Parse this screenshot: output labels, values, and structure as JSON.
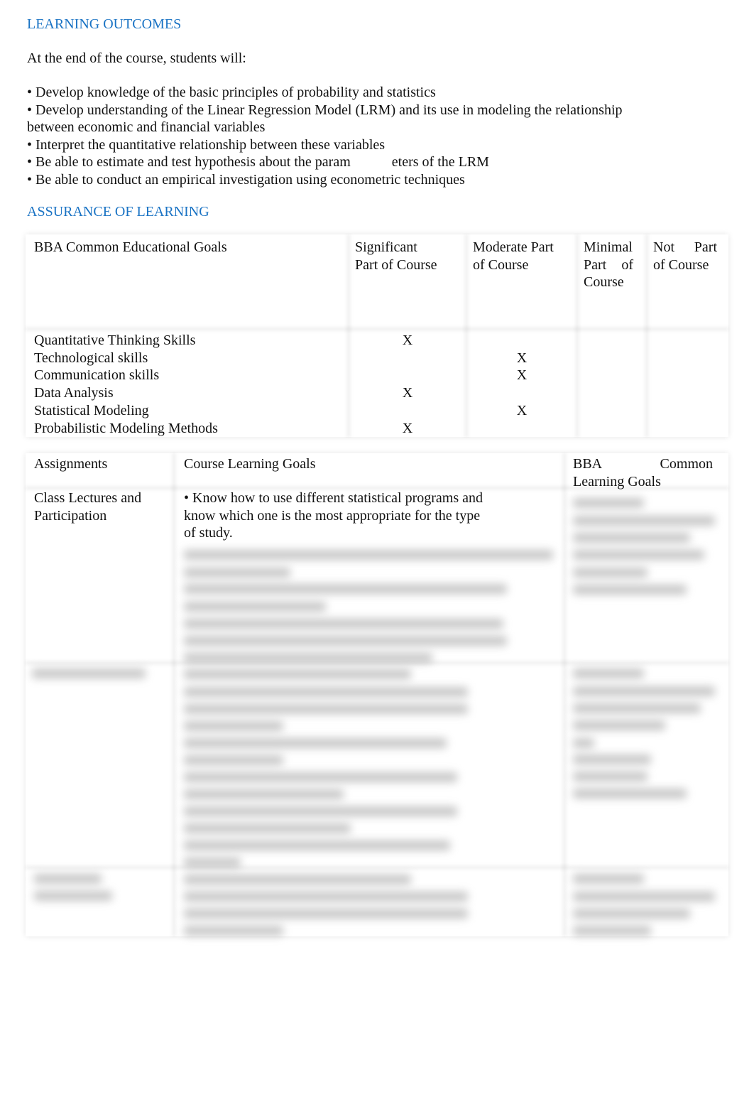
{
  "learning_outcomes": {
    "heading": "LEARNING OUTCOMES",
    "intro": "At the end of the course, students will:",
    "items": [
      "• Develop knowledge of the basic principles of probability and statistics",
      "• Develop  understanding of the Linear Regression Model (LRM) and its use in modeling the relationship",
      "between economic and financial variables",
      "• Interpret the quantitative relationship between these variables",
      "• Be able to conduct an empirical investigation using econometric techniques"
    ],
    "split_item": {
      "part1": "• Be able to estimate and test hypothesis about the param",
      "part2": "eters of the LRM"
    }
  },
  "assurance": {
    "heading": "ASSURANCE OF LEARNING",
    "goals_table": {
      "headers": {
        "goal": "BBA Common Educational Goals",
        "significant": [
          "Significant",
          "Part of Course"
        ],
        "moderate": [
          "Moderate Part",
          "of Course"
        ],
        "minimal": [
          "Minimal",
          "Part    of",
          "Course"
        ],
        "not": [
          "Not     Part",
          "of Course"
        ]
      },
      "mark": "X",
      "rows": [
        {
          "goal": "Quantitative Thinking Skills",
          "level": "significant"
        },
        {
          "goal": "Technological skills",
          "level": "moderate"
        },
        {
          "goal": "Communication skills",
          "level": "moderate"
        },
        {
          "goal": "Data Analysis",
          "level": "significant"
        },
        {
          "goal": "Statistical Modeling",
          "level": "moderate"
        },
        {
          "goal": "Probabilistic Modeling Methods",
          "level": "significant"
        }
      ]
    },
    "assignments_table": {
      "headers": {
        "assignments": "Assignments",
        "course_goals": "Course Learning Goals",
        "bba_goals_1": "BBA",
        "bba_goals_1b": "Common",
        "bba_goals_2": "Learning Goals"
      },
      "rows": [
        {
          "assignment": [
            "Class Lectures and",
            "Participation"
          ],
          "course_goals_visible": [
            "• Know how to use different statistical programs and",
            "know which one is the most appropriate for the type",
            "of study."
          ]
        }
      ]
    }
  }
}
